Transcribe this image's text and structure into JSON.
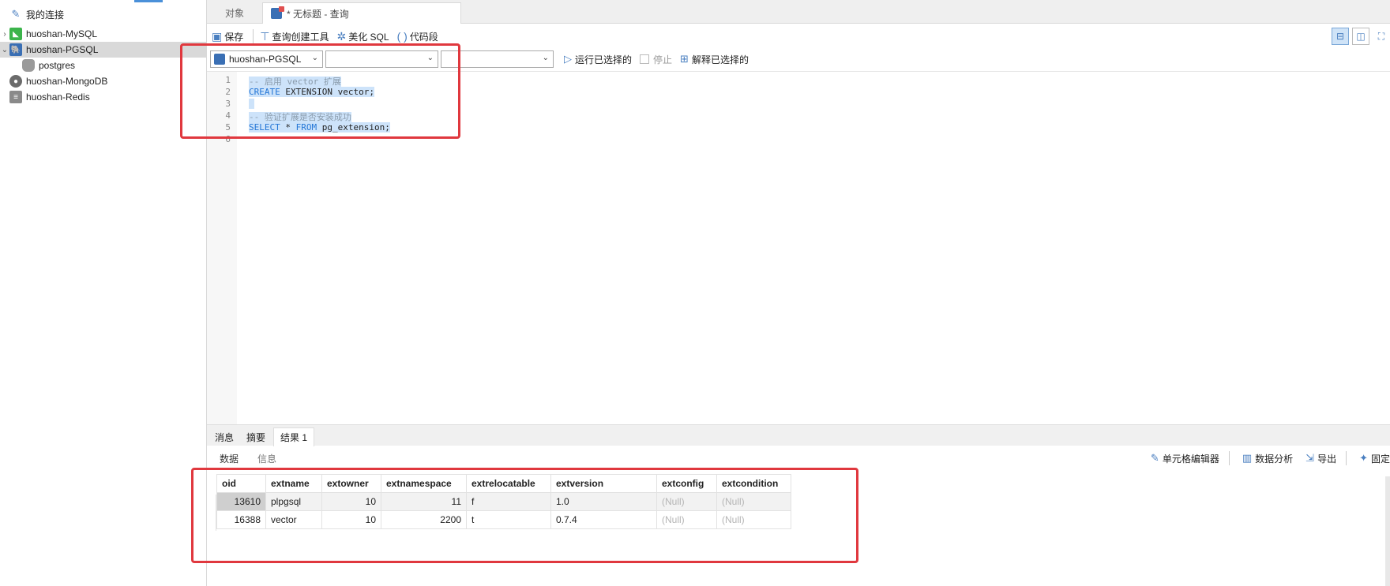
{
  "sidebar": {
    "root_label": "我的连接",
    "connections": [
      {
        "label": "huoshan-MySQL",
        "caret": "›"
      },
      {
        "label": "huoshan-PGSQL",
        "caret": "⌄"
      },
      {
        "label": "postgres",
        "caret": ""
      },
      {
        "label": "huoshan-MongoDB",
        "caret": ""
      },
      {
        "label": "huoshan-Redis",
        "caret": ""
      }
    ]
  },
  "tabs": {
    "objects": "对象",
    "active": "* 无标题 - 查询"
  },
  "toolbar": {
    "save": "保存",
    "query_builder": "查询创建工具",
    "beautify": "美化 SQL",
    "snippet": "代码段"
  },
  "selectors": {
    "connection": "huoshan-PGSQL",
    "database": "",
    "schema": ""
  },
  "actions": {
    "run_selected": "运行已选择的",
    "stop": "停止",
    "explain_selected": "解释已选择的"
  },
  "editor": {
    "line_numbers": [
      "1",
      "2",
      "3",
      "4",
      "5",
      "6"
    ],
    "lines": [
      [
        {
          "t": "-- 启用 vector 扩展",
          "c": "cmt"
        }
      ],
      [
        {
          "t": "CREATE",
          "c": "kw"
        },
        {
          "t": " EXTENSION vector;",
          "c": "plain"
        }
      ],
      [
        {
          "t": " ",
          "c": "plain"
        }
      ],
      [
        {
          "t": "-- 验证扩展是否安装成功",
          "c": "cmt"
        }
      ],
      [
        {
          "t": "SELECT",
          "c": "kw"
        },
        {
          "t": " * ",
          "c": "plain"
        },
        {
          "t": "FROM",
          "c": "kw"
        },
        {
          "t": " pg_extension;",
          "c": "plain"
        }
      ],
      []
    ]
  },
  "result_tabs": [
    "消息",
    "摘要",
    "结果 1"
  ],
  "result_subtabs": [
    "数据",
    "信息"
  ],
  "result_tools": {
    "cell_editor": "单元格编辑器",
    "data_analysis": "数据分析",
    "export": "导出",
    "pin": "固定"
  },
  "grid": {
    "columns": [
      "oid",
      "extname",
      "extowner",
      "extnamespace",
      "extrelocatable",
      "extversion",
      "extconfig",
      "extcondition"
    ],
    "rows": [
      [
        "13610",
        "plpgsql",
        "10",
        "11",
        "f",
        "1.0",
        "(Null)",
        "(Null)"
      ],
      [
        "16388",
        "vector",
        "10",
        "2200",
        "t",
        "0.7.4",
        "(Null)",
        "(Null)"
      ]
    ]
  }
}
